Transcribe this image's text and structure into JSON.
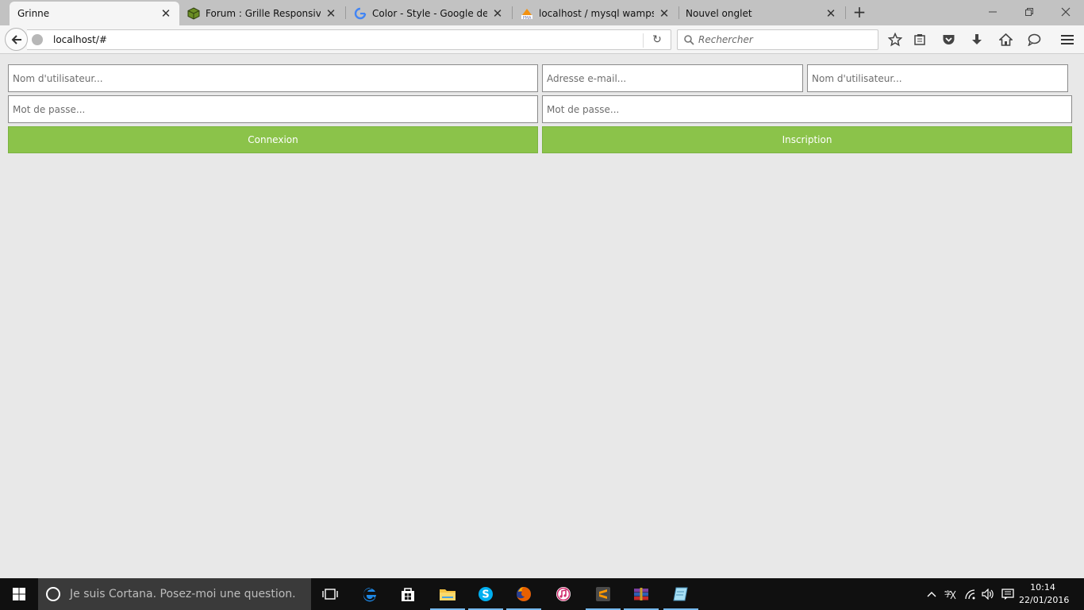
{
  "browser": {
    "tabs": [
      {
        "title": "Grinne",
        "active": true,
        "icon": "no-icon"
      },
      {
        "title": "Forum : Grille Responsive |...",
        "active": false,
        "icon": "cube-icon"
      },
      {
        "title": "Color - Style - Google desi...",
        "active": false,
        "icon": "google-icon"
      },
      {
        "title": "localhost / mysql wampse...",
        "active": false,
        "icon": "phpmyadmin-icon"
      },
      {
        "title": "Nouvel onglet",
        "active": false,
        "icon": "no-icon"
      }
    ],
    "new_tab_icon": "plus-icon",
    "url": "localhost/#",
    "search_placeholder": "Rechercher"
  },
  "page": {
    "login": {
      "username_placeholder": "Nom d'utilisateur...",
      "password_placeholder": "Mot de passe...",
      "button_label": "Connexion"
    },
    "register": {
      "email_placeholder": "Adresse e-mail...",
      "username_placeholder": "Nom d'utilisateur...",
      "password_placeholder": "Mot de passe...",
      "button_label": "Inscription"
    },
    "accent_color": "#8bc34a",
    "background_color": "#e8e8e8"
  },
  "taskbar": {
    "cortana_placeholder": "Je suis Cortana. Posez-moi une question.",
    "time": "10:14",
    "date": "22/01/2016",
    "pinned_apps": [
      "task-view-icon",
      "edge-icon",
      "store-icon",
      "file-explorer-icon",
      "skype-icon",
      "firefox-icon",
      "itunes-icon",
      "sublime-text-icon",
      "winrar-icon",
      "notepad-icon"
    ]
  }
}
